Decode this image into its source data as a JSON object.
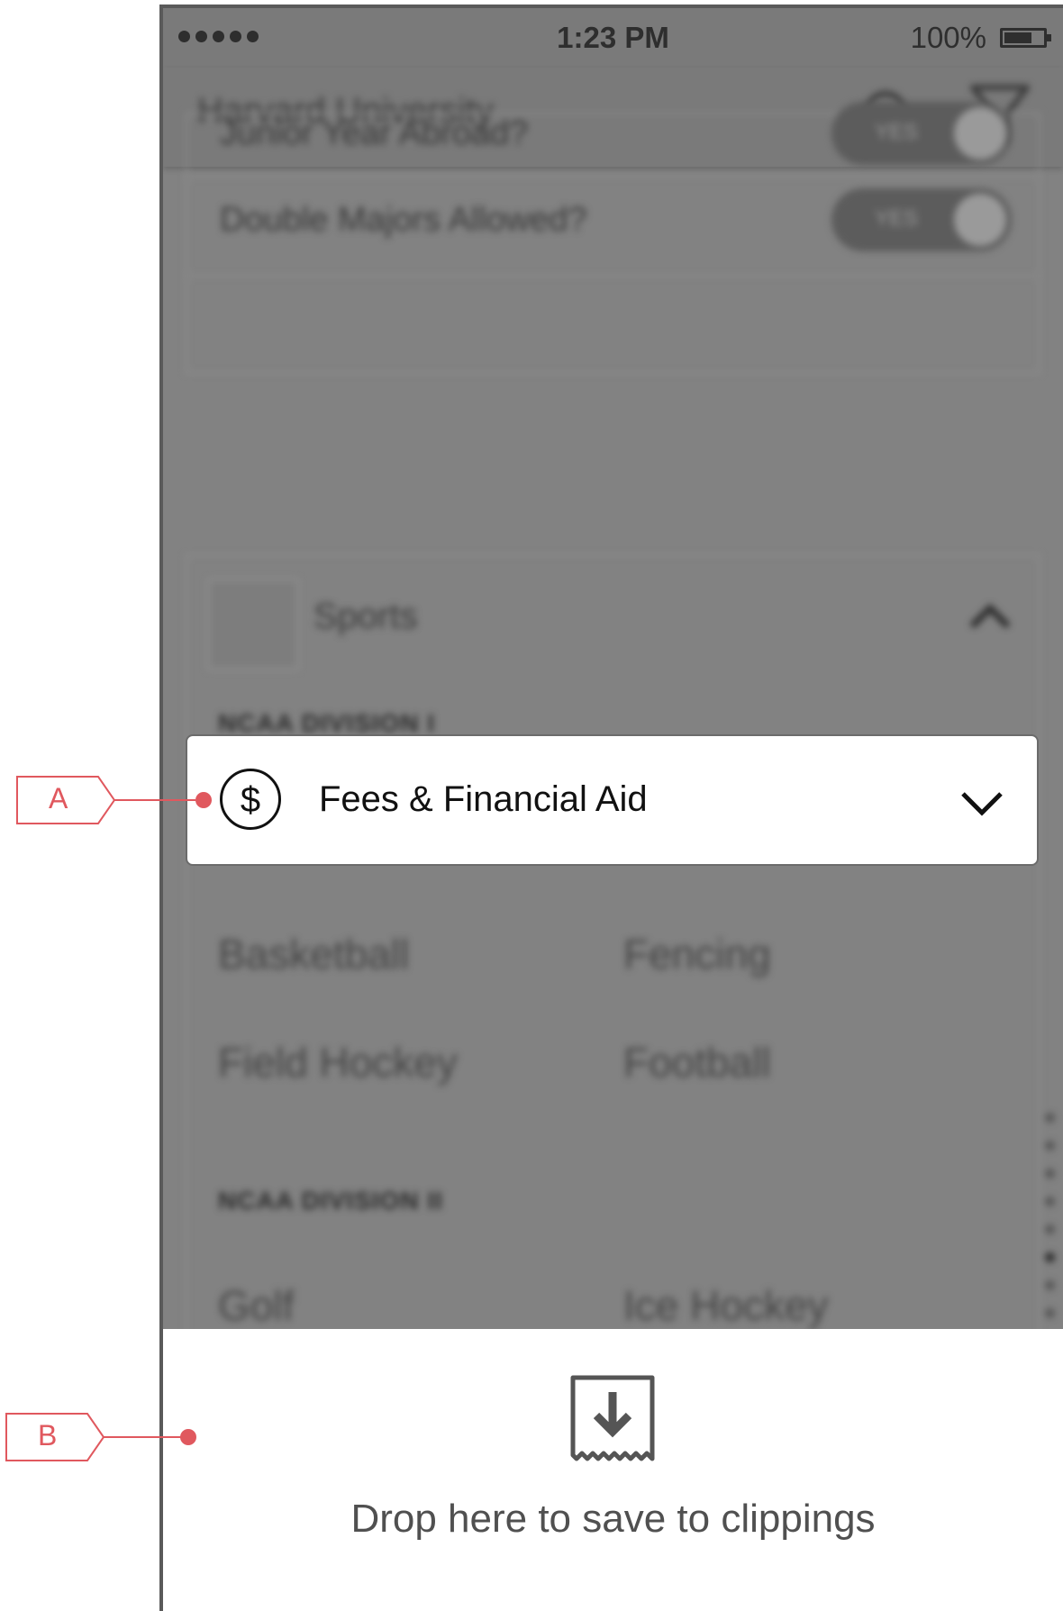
{
  "status_bar": {
    "time": "1:23 PM",
    "battery": "100%"
  },
  "app_bar": {
    "title": "Harvard University"
  },
  "background": {
    "rows": [
      {
        "label": "Junior Year Abroad?",
        "toggle": "YES"
      },
      {
        "label": "Double Majors Allowed?",
        "toggle": "YES"
      }
    ],
    "sports_section": {
      "title": "Sports",
      "divisions": [
        {
          "name": "NCAA DIVISION I",
          "sports": [
            "Basketball",
            "Fencing",
            "Field Hockey",
            "Football"
          ]
        },
        {
          "name": "NCAA DIVISION II",
          "sports": [
            "Golf",
            "Ice Hockey"
          ]
        }
      ]
    }
  },
  "drag_item": {
    "label": "Fees & Financial Aid",
    "icon": "dollar-icon",
    "symbol": "$"
  },
  "drop_zone": {
    "text": "Drop here to save to clippings",
    "icon": "clipping-download-icon"
  },
  "annotations": {
    "a": "A",
    "b": "B",
    "color": "#e0585e"
  }
}
